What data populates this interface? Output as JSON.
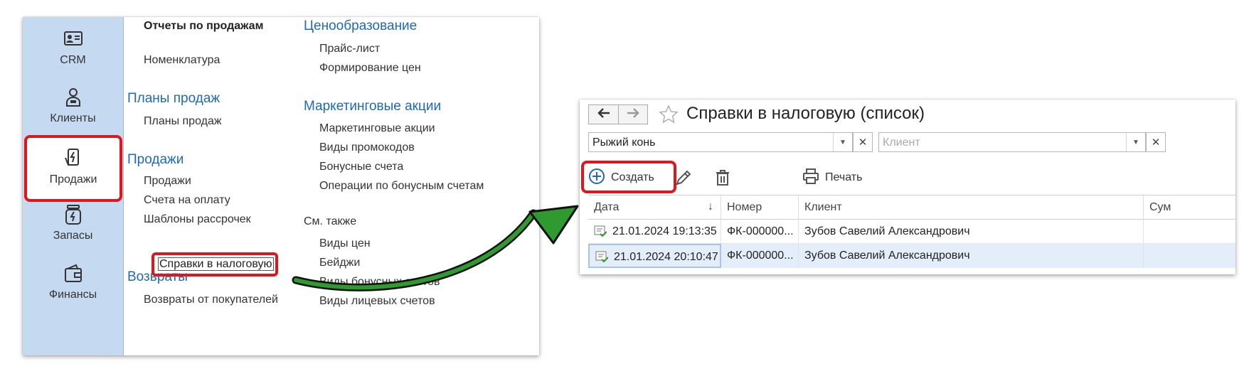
{
  "sections": [
    {
      "label": "CRM",
      "icon": "id-card-icon"
    },
    {
      "label": "Клиенты",
      "icon": "person-icon"
    },
    {
      "label": "Продажи",
      "icon": "sales-card-icon",
      "active": true
    },
    {
      "label": "Запасы",
      "icon": "inventory-jar-icon"
    },
    {
      "label": "Финансы",
      "icon": "wallet-icon"
    }
  ],
  "menu": {
    "col1": {
      "reports_heading": "Отчеты по продажам",
      "nomenclature": "Номенклатура",
      "plans_group": "Планы продаж",
      "plans_item": "Планы продаж",
      "sales_group": "Продажи",
      "sales_items": [
        "Продажи",
        "Счета на оплату",
        "Шаблоны рассрочек",
        "Справки в налоговую"
      ],
      "returns_group": "Возвраты",
      "returns_item": "Возвраты от покупателей"
    },
    "col2": {
      "pricing_group": "Ценообразование",
      "pricing_items": [
        "Прайс-лист",
        "Формирование цен"
      ],
      "marketing_group": "Маркетинговые акции",
      "marketing_items": [
        "Маркетинговые акции",
        "Виды промокодов",
        "Бонусные счета",
        "Операции по бонусным счетам"
      ],
      "see_also": "См. также",
      "see_also_items": [
        "Виды цен",
        "Бейджи",
        "Виды бонусных счетов",
        "Виды лицевых счетов"
      ]
    }
  },
  "window": {
    "title": "Справки в налоговую (список)",
    "filter_org": "Рыжий конь",
    "filter_client_placeholder": "Клиент",
    "create_label": "Создать",
    "print_label": "Печать",
    "columns": [
      "Дата",
      "Номер",
      "Клиент",
      "Сум"
    ],
    "rows": [
      {
        "date": "21.01.2024 19:13:35",
        "number": "ФК-000000...",
        "client": "Зубов Савелий Александрович"
      },
      {
        "date": "21.01.2024 20:10:47",
        "number": "ФК-000000...",
        "client": "Зубов Савелий Александрович",
        "selected": true
      }
    ]
  },
  "colors": {
    "sidebar_bg": "#c5d9f1",
    "group_heading": "#1e69b9",
    "highlight": "#e0161f",
    "arrow": "#1f8a1f",
    "selected_row": "#e4eefb"
  }
}
